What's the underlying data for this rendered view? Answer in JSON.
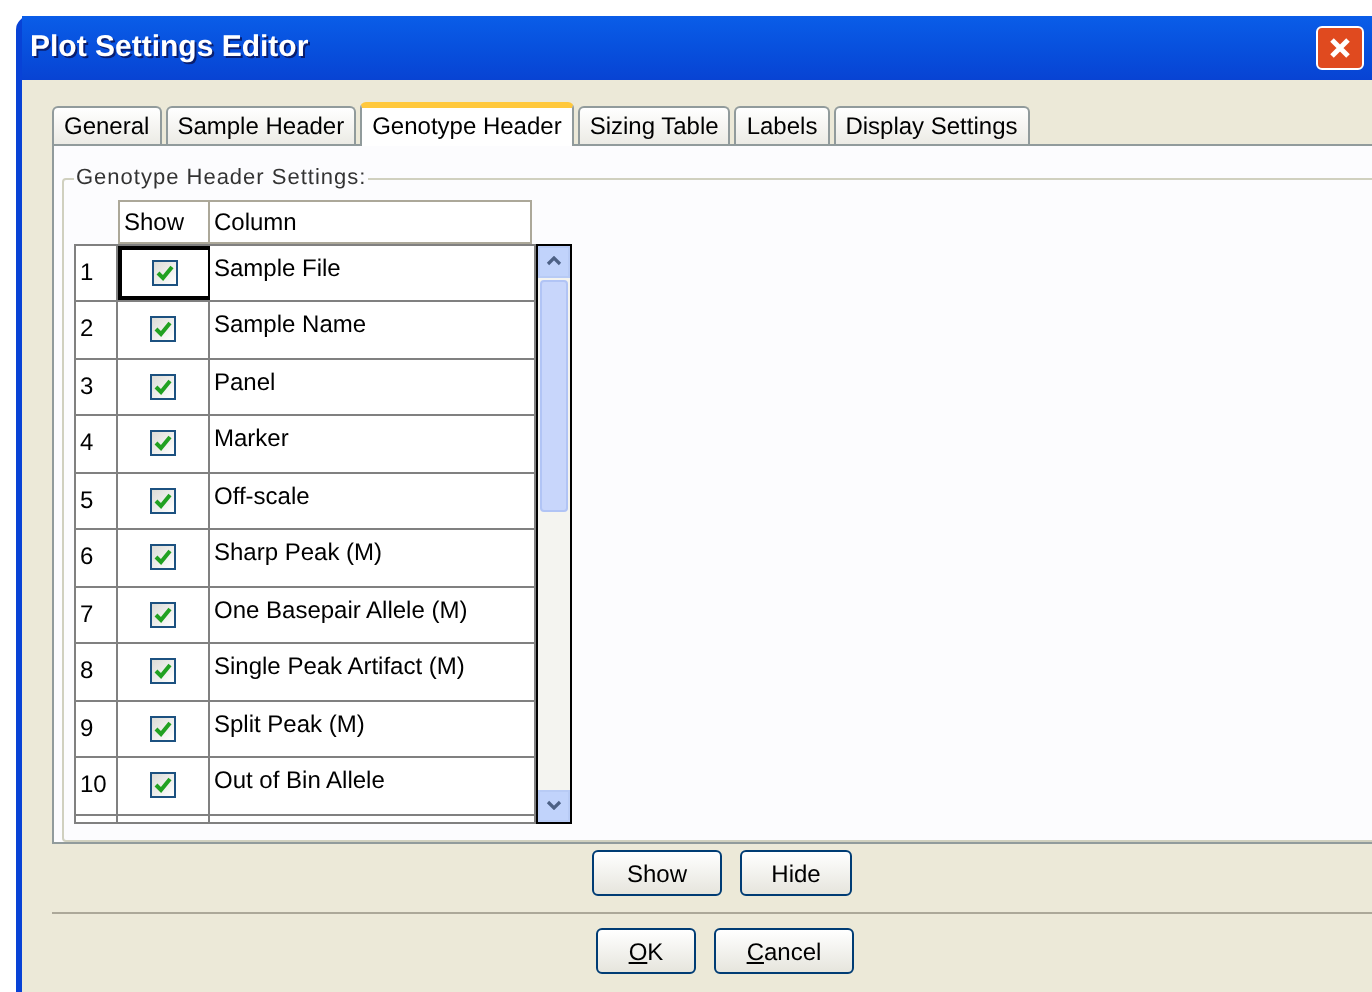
{
  "window": {
    "title": "Plot Settings Editor"
  },
  "tabs": [
    {
      "label": "General",
      "selected": false
    },
    {
      "label": "Sample Header",
      "selected": false
    },
    {
      "label": "Genotype Header",
      "selected": true
    },
    {
      "label": "Sizing Table",
      "selected": false
    },
    {
      "label": "Labels",
      "selected": false
    },
    {
      "label": "Display Settings",
      "selected": false
    }
  ],
  "group": {
    "title": "Genotype Header Settings:"
  },
  "table": {
    "columns": [
      "Show",
      "Column"
    ],
    "rows": [
      {
        "index": "1",
        "checked": true,
        "column": "Sample File",
        "selected": true
      },
      {
        "index": "2",
        "checked": true,
        "column": "Sample Name",
        "selected": false
      },
      {
        "index": "3",
        "checked": true,
        "column": "Panel",
        "selected": false
      },
      {
        "index": "4",
        "checked": true,
        "column": "Marker",
        "selected": false
      },
      {
        "index": "5",
        "checked": true,
        "column": "Off-scale",
        "selected": false
      },
      {
        "index": "6",
        "checked": true,
        "column": "Sharp Peak (M)",
        "selected": false
      },
      {
        "index": "7",
        "checked": true,
        "column": "One Basepair Allele (M)",
        "selected": false
      },
      {
        "index": "8",
        "checked": true,
        "column": "Single Peak Artifact (M)",
        "selected": false
      },
      {
        "index": "9",
        "checked": true,
        "column": "Split Peak (M)",
        "selected": false
      },
      {
        "index": "10",
        "checked": true,
        "column": "Out of Bin Allele",
        "selected": false
      }
    ]
  },
  "table_buttons": [
    "Show",
    "Hide"
  ],
  "dialog_buttons": [
    "OK",
    "Cancel"
  ]
}
